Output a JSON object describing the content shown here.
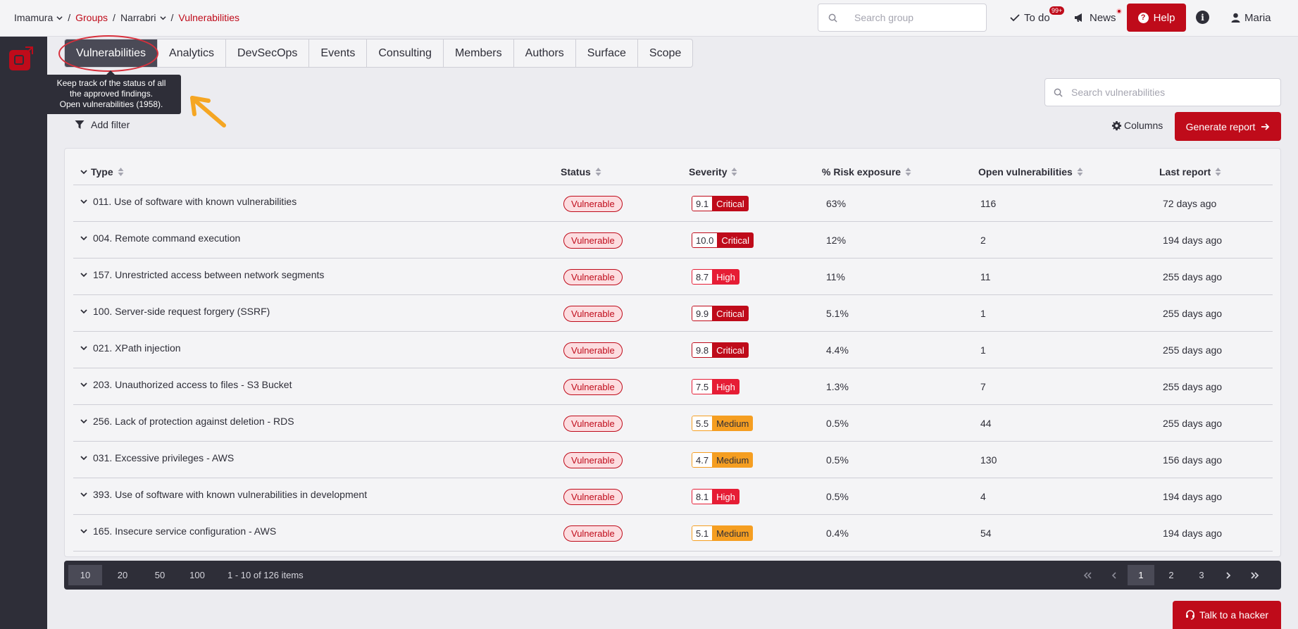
{
  "breadcrumb": {
    "org": "Imamura",
    "groups": "Groups",
    "group": "Narrabri",
    "current": "Vulnerabilities"
  },
  "topbar": {
    "search_placeholder": "Search group",
    "todo_label": "To do",
    "todo_badge": "99+",
    "news_label": "News",
    "help_label": "Help",
    "user_label": "Maria"
  },
  "tabs": [
    "Vulnerabilities",
    "Analytics",
    "DevSecOps",
    "Events",
    "Consulting",
    "Members",
    "Authors",
    "Surface",
    "Scope"
  ],
  "tooltip": {
    "line1": "Keep track of the status of all",
    "line2": "the approved findings.",
    "line3": "Open vulnerabilities (1958)."
  },
  "toolbar": {
    "add_filter": "Add filter",
    "search_placeholder": "Search vulnerabilities",
    "columns": "Columns",
    "generate_report": "Generate report"
  },
  "table": {
    "headers": [
      "Type",
      "Status",
      "Severity",
      "% Risk exposure",
      "Open vulnerabilities",
      "Last report"
    ],
    "rows": [
      {
        "type": "011. Use of software with known vulnerabilities",
        "status": "Vulnerable",
        "score": "9.1",
        "level": "Critical",
        "risk": "63%",
        "open": "116",
        "last": "72 days ago"
      },
      {
        "type": "004. Remote command execution",
        "status": "Vulnerable",
        "score": "10.0",
        "level": "Critical",
        "risk": "12%",
        "open": "2",
        "last": "194 days ago"
      },
      {
        "type": "157. Unrestricted access between network segments",
        "status": "Vulnerable",
        "score": "8.7",
        "level": "High",
        "risk": "11%",
        "open": "11",
        "last": "255 days ago"
      },
      {
        "type": "100. Server-side request forgery (SSRF)",
        "status": "Vulnerable",
        "score": "9.9",
        "level": "Critical",
        "risk": "5.1%",
        "open": "1",
        "last": "255 days ago"
      },
      {
        "type": "021. XPath injection",
        "status": "Vulnerable",
        "score": "9.8",
        "level": "Critical",
        "risk": "4.4%",
        "open": "1",
        "last": "255 days ago"
      },
      {
        "type": "203. Unauthorized access to files - S3 Bucket",
        "status": "Vulnerable",
        "score": "7.5",
        "level": "High",
        "risk": "1.3%",
        "open": "7",
        "last": "255 days ago"
      },
      {
        "type": "256. Lack of protection against deletion - RDS",
        "status": "Vulnerable",
        "score": "5.5",
        "level": "Medium",
        "risk": "0.5%",
        "open": "44",
        "last": "255 days ago"
      },
      {
        "type": "031. Excessive privileges - AWS",
        "status": "Vulnerable",
        "score": "4.7",
        "level": "Medium",
        "risk": "0.5%",
        "open": "130",
        "last": "156 days ago"
      },
      {
        "type": "393. Use of software with known vulnerabilities in development",
        "status": "Vulnerable",
        "score": "8.1",
        "level": "High",
        "risk": "0.5%",
        "open": "4",
        "last": "194 days ago"
      },
      {
        "type": "165. Insecure service configuration - AWS",
        "status": "Vulnerable",
        "score": "5.1",
        "level": "Medium",
        "risk": "0.4%",
        "open": "54",
        "last": "194 days ago"
      }
    ]
  },
  "pagination": {
    "sizes": [
      "10",
      "20",
      "50",
      "100"
    ],
    "active_size": "10",
    "items_info": "1 - 10 of 126 items",
    "pages": [
      "1",
      "2",
      "3"
    ],
    "active_page": "1"
  },
  "talk_button": "Talk to a hacker",
  "colors": {
    "brand": "#bf0b1a",
    "critical": "#bf0b1a",
    "high": "#e61d35",
    "medium": "#f59e21",
    "sidebar": "#2e2e38"
  }
}
